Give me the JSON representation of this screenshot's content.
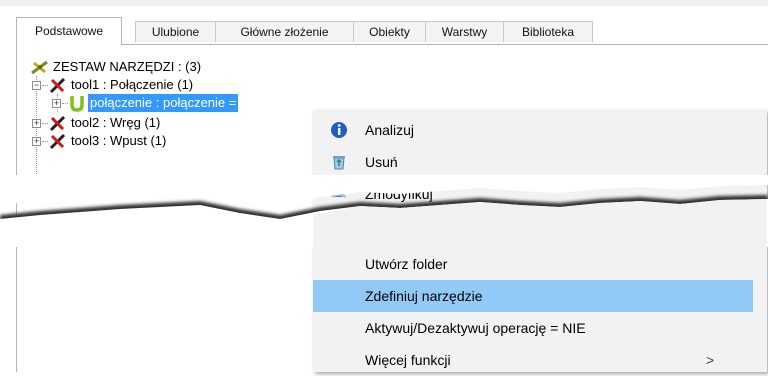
{
  "tabs": [
    "Podstawowe",
    "Ulubione",
    "Główne złożenie",
    "Obiekty",
    "Warstwy",
    "Biblioteka"
  ],
  "tree": {
    "root": "ZESTAW NARZĘDZI :  (3)",
    "items": [
      {
        "label": "tool1 : Połączenie (1)",
        "expand": "−"
      },
      {
        "label": "połączenie : połączenie =",
        "expand": "+"
      },
      {
        "label": "tool2 : Wręg (1)",
        "expand": "+"
      },
      {
        "label": "tool3 : Wpust (1)",
        "expand": "+"
      }
    ]
  },
  "context_menu": {
    "items_top": [
      {
        "label": "Analizuj",
        "icon": "info-icon"
      },
      {
        "label": "Usuń",
        "icon": "recycle-bin-icon"
      },
      {
        "label": "Zmodyfikuj",
        "icon": "modify-icon"
      }
    ],
    "items_bottom": [
      {
        "label": "Utwórz folder"
      },
      {
        "label": "Zdefiniuj narzędzie"
      },
      {
        "label": "Aktywuj/Dezaktywuj operację = NIE"
      },
      {
        "label": "Więcej funkcji",
        "submenu_arrow": ">"
      }
    ]
  },
  "colors": {
    "selection": "#3399ff",
    "menu_highlight": "#91c9f7",
    "menu_bg": "#f2f2f2"
  }
}
